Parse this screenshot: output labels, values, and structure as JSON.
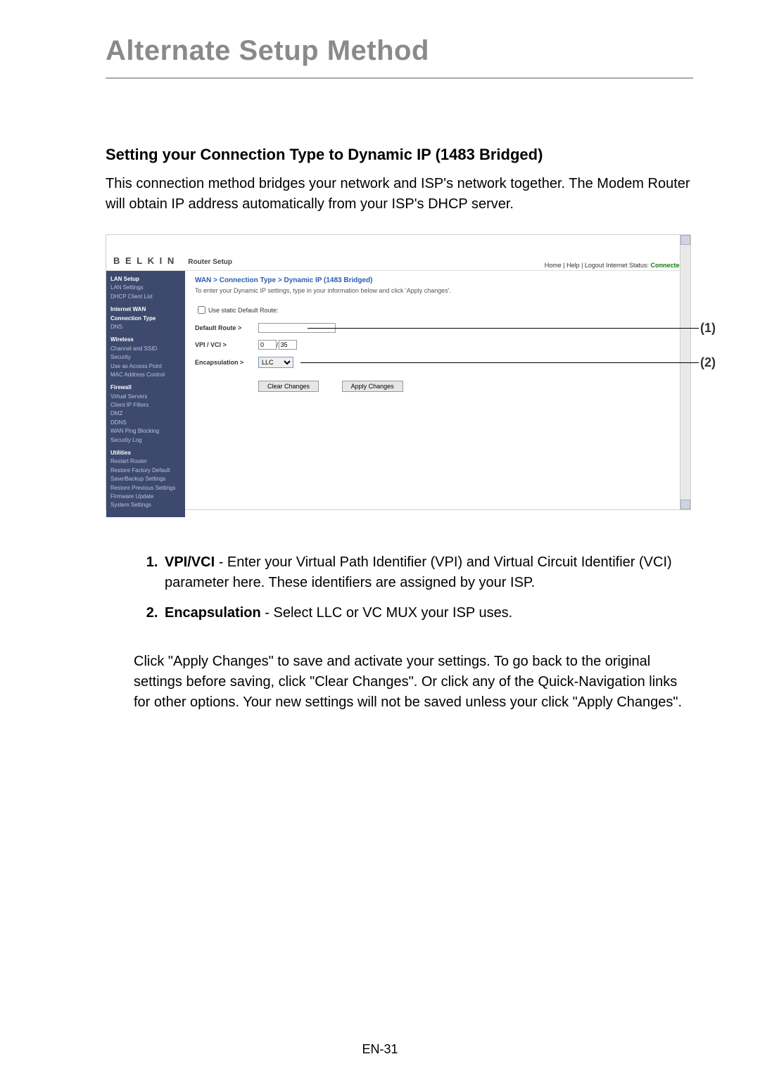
{
  "page_title": "Alternate Setup Method",
  "subhead": "Setting your Connection Type to Dynamic IP (1483 Bridged)",
  "intro": "This connection method bridges your network and ISP's network together. The Modem Router will obtain IP address automatically from your ISP's DHCP server.",
  "list": [
    {
      "label": "VPI/VCI",
      "text": " - Enter your Virtual Path Identifier (VPI) and Virtual Circuit Identifier (VCI) parameter here. These identifiers are assigned by your ISP."
    },
    {
      "label": "Encapsulation",
      "text": " - Select LLC or VC MUX your ISP uses."
    }
  ],
  "closing": "Click \"Apply Changes\" to save and activate your settings. To go back to the original settings before saving, click \"Clear Changes\". Or click any of the Quick-Navigation links for other options. Your new settings will not be saved unless your click \"Apply Changes\".",
  "pagenum": "EN-31",
  "shot": {
    "brand": "B E L K I N",
    "setup": "Router Setup",
    "header_links": "Home | Help | Logout   Internet Status: ",
    "status": "Connected",
    "side": {
      "cat1": "LAN Setup",
      "i1a": "LAN Settings",
      "i1b": "DHCP Client List",
      "cat2": "Internet WAN",
      "i2a": "Connection Type",
      "i2b": "DNS",
      "cat3": "Wireless",
      "i3a": "Channel and SSID",
      "i3b": "Security",
      "i3c": "Use as Access Point",
      "i3d": "MAC Address Control",
      "cat4": "Firewall",
      "i4a": "Virtual Servers",
      "i4b": "Client IP Filters",
      "i4c": "DMZ",
      "i4d": "DDNS",
      "i4e": "WAN Ping Blocking",
      "i4f": "Security Log",
      "cat5": "Utilities",
      "i5a": "Restart Router",
      "i5b": "Restore Factory Default",
      "i5c": "Save/Backup Settings",
      "i5d": "Restore Previous Settings",
      "i5e": "Firmware Update",
      "i5f": "System Settings"
    },
    "main": {
      "breadcrumb": "WAN > Connection Type > Dynamic IP (1483 Bridged)",
      "desc": "To enter your Dynamic IP settings, type in your information below and click 'Apply changes'.",
      "static_route": "Use static Default Route:",
      "default_route": "Default Route >",
      "vpi_vci": "VPI / VCI >",
      "vpi_val": "0",
      "vci_val": "35",
      "slash": " / ",
      "encap": "Encapsulation >",
      "encap_sel": "LLC",
      "btn_clear": "Clear Changes",
      "btn_apply": "Apply Changes",
      "c1": "(1)",
      "c2": "(2)"
    }
  }
}
